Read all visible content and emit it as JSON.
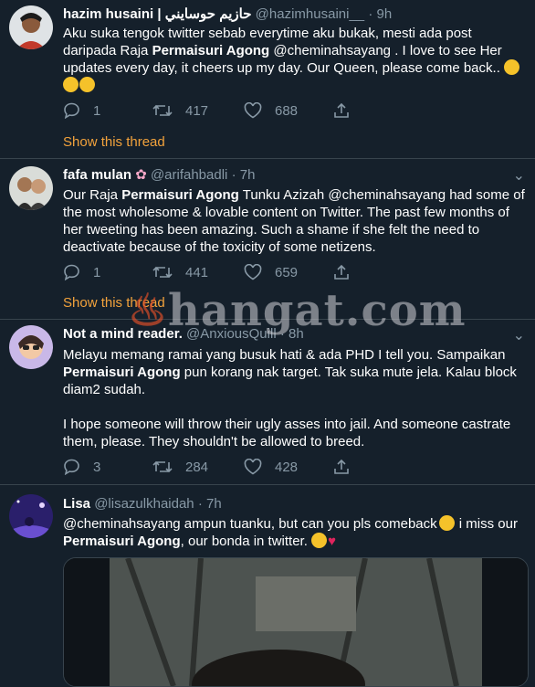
{
  "watermark": {
    "text": "hangat.com"
  },
  "colors": {
    "background": "#15202b",
    "muted": "#8899a6",
    "link": "#f2a23c",
    "divider": "#38444d"
  },
  "tweets": [
    {
      "name": "hazim husaini | حازيم حوسايني",
      "handle": "@hazimhusaini__",
      "time": "· 9h",
      "text_segments": [
        "Aku suka tengok twitter sebab everytime aku bukak, mesti ada post daripada Raja ",
        "Permaisuri Agong",
        " @cheminahsayang . I love to see Her updates every day, it cheers up my day. Our Queen, please come back.."
      ],
      "emoji_icons": [
        "crying-face-emoji",
        "crying-face-emoji",
        "crying-face-emoji"
      ],
      "replies": "1",
      "retweets": "417",
      "likes": "688",
      "show_thread": "Show this thread"
    },
    {
      "name": "fafa mulan",
      "handle": "@arifahbadli",
      "time": "· 7h",
      "badge_icon": "cherry-blossom-emoji",
      "text_segments": [
        "Our Raja ",
        "Permaisuri Agong",
        " Tunku Azizah @cheminahsayang had some of the most wholesome & lovable content on Twitter. The past few months of her tweeting has been amazing. Such a shame if she felt the need to deactivate because of the toxicity of some netizens."
      ],
      "replies": "1",
      "retweets": "441",
      "likes": "659",
      "show_thread": "Show this thread"
    },
    {
      "name": "Not a mind reader.",
      "handle": "@AnxiousQuill",
      "time": "· 8h",
      "text_segments": [
        "Melayu memang ramai yang busuk hati & ada PHD I tell you. Sampaikan ",
        "Permaisuri Agong",
        " pun korang nak target. Tak suka mute jela. Kalau block diam2 sudah."
      ],
      "paragraph2": "I hope someone will throw their ugly asses into jail. And someone castrate them, please. They shouldn't be allowed to breed.",
      "replies": "3",
      "retweets": "284",
      "likes": "428"
    },
    {
      "name": "Lisa",
      "handle": "@lisazulkhaidah",
      "time": "· 7h",
      "text_segments": [
        "@cheminahsayang ampun tuanku, but can you pls comeback",
        " i miss our ",
        "Permaisuri Agong",
        ", our bonda in twitter. "
      ],
      "emoji_icons": [
        "rolling-eyes-emoji",
        "loudly-crying-emoji",
        "red-heart-emoji"
      ]
    }
  ]
}
